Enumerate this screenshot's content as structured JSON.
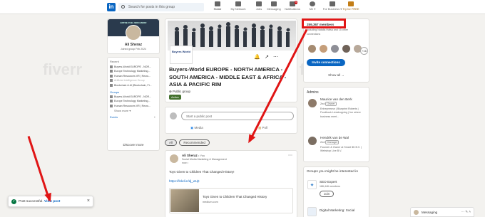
{
  "nav": {
    "logo": "in",
    "search_placeholder": "Search for posts in this group",
    "items": [
      {
        "label": "Home"
      },
      {
        "label": "My Network"
      },
      {
        "label": "Jobs"
      },
      {
        "label": "Messaging"
      },
      {
        "label": "Notifications",
        "badge": "9"
      },
      {
        "label": "Me ▾"
      },
      {
        "label": "For Business ▾"
      },
      {
        "label": "Try for FREE"
      }
    ]
  },
  "profile": {
    "banner": "ENTRE FUEL NIRO MERR",
    "name": "Ali Sheraz",
    "subtitle": "Joined group Feb 2024"
  },
  "groups": {
    "recent_label": "Recent",
    "recent": [
      "Buyers-World  EUROPE - NOR...",
      "Europe Technology Marketing...",
      "Human Resources VR | Recru...",
      "Artificial Intelligence Group",
      "Blockchain & AI (Blockchain, Fi..."
    ],
    "groups_label": "Groups",
    "groups": [
      "Buyers-World  EUROPE - NOR...",
      "Europe Technology Marketing...",
      "Human Resources VR | Recru..."
    ],
    "show_more": "Show more ▾",
    "events_label": "Events",
    "events_plus": "+",
    "discover": "Discover more"
  },
  "group": {
    "owner_logo": "Buyers World",
    "title": "Buyers-World  EUROPE - NORTH AMERICA - SOUTH AMERICA - MIDDLE EAST & AFRICA - ASIA & PACIFIC RIM",
    "privacy": "Public group",
    "active_badge": "Active",
    "start_post": "Start a public post",
    "media": "Media",
    "poll": "Poll"
  },
  "filters": {
    "all": "All",
    "recommended": "Recommended"
  },
  "post": {
    "author": "Ali Sheraz",
    "time": "• You",
    "role": "Social Media Marketing & Management",
    "age": "now •",
    "text": "Toys Given to Children That Changed History!",
    "link": "https://lnkd.in/dj_wUjt",
    "preview_title": "Toys Given to Children That Changed History",
    "preview_domain": "medium.com",
    "more": "⋯"
  },
  "members": {
    "count": "259,367 members",
    "line1": "including Natalia Hafsa and 15 other",
    "line2": "connections",
    "more": "+16",
    "invite": "Invite connections",
    "show_all": "Show all →"
  },
  "admins": {
    "label": "Admins",
    "list": [
      {
        "name": "Maurice van den Berk",
        "degree": "2nd",
        "tag": "Owner",
        "desc": "Entrepreneur | Blueprint Roberts | Foodbook Liveshopping | fun where business meet...",
        "highlight": "Manager"
      },
      {
        "name": "Hendrik van de Wal",
        "degree": "2nd",
        "tag": "Manager",
        "desc": "Founder & Owner at Smart life B.V. | Webshop Live B.V."
      }
    ]
  },
  "suggest": {
    "label": "Groups you might be interested in",
    "items": [
      {
        "name": "SEO Expert",
        "members": "186,446 members",
        "join": "Join"
      },
      {
        "name": "Digital Marketing: Social",
        "members": "",
        "join": ""
      }
    ]
  },
  "toast": {
    "text": "Post successful.",
    "link": "View post",
    "close": "×"
  },
  "messaging": {
    "label": "Messaging",
    "icons": "⋯  ✎  ˄"
  },
  "watermark": "fiverr"
}
